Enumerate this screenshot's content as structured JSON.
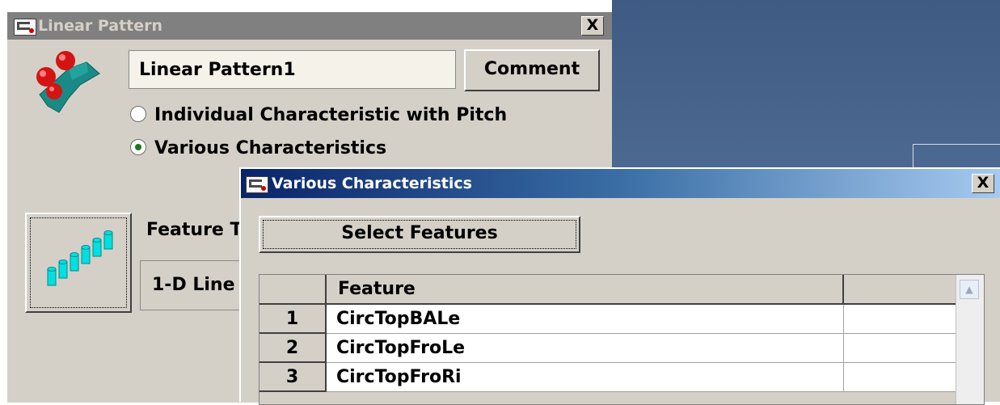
{
  "main_dialog": {
    "title": "Linear Pattern",
    "close_label": "X",
    "name_value": "Linear Pattern1",
    "comment_label": "Comment",
    "radio_options": [
      {
        "label": "Individual Characteristic with Pitch",
        "checked": false
      },
      {
        "label": "Various Characteristics",
        "checked": true
      }
    ],
    "feature_type_label": "Feature T",
    "feature_type_value": "1-D Line"
  },
  "various_dialog": {
    "title": "Various Characteristics",
    "close_label": "X",
    "select_features_label": "Select Features",
    "table": {
      "columns": [
        "",
        "Feature",
        ""
      ],
      "rows": [
        {
          "num": "1",
          "feature": "CircTopBALe",
          "extra": ""
        },
        {
          "num": "2",
          "feature": "CircTopFroLe",
          "extra": ""
        },
        {
          "num": "3",
          "feature": "CircTopFroRi",
          "extra": ""
        }
      ]
    }
  },
  "icons": [
    "app-icon",
    "linear-pattern-icon",
    "feature-array-icon",
    "scroll-up-arrow-icon"
  ],
  "colors": {
    "dialog_bg": "#d4d0c8",
    "active_title_start": "#0a246a",
    "active_title_end": "#a6caf0",
    "inactive_title": "#808080",
    "viewport": "#4d6a92"
  }
}
